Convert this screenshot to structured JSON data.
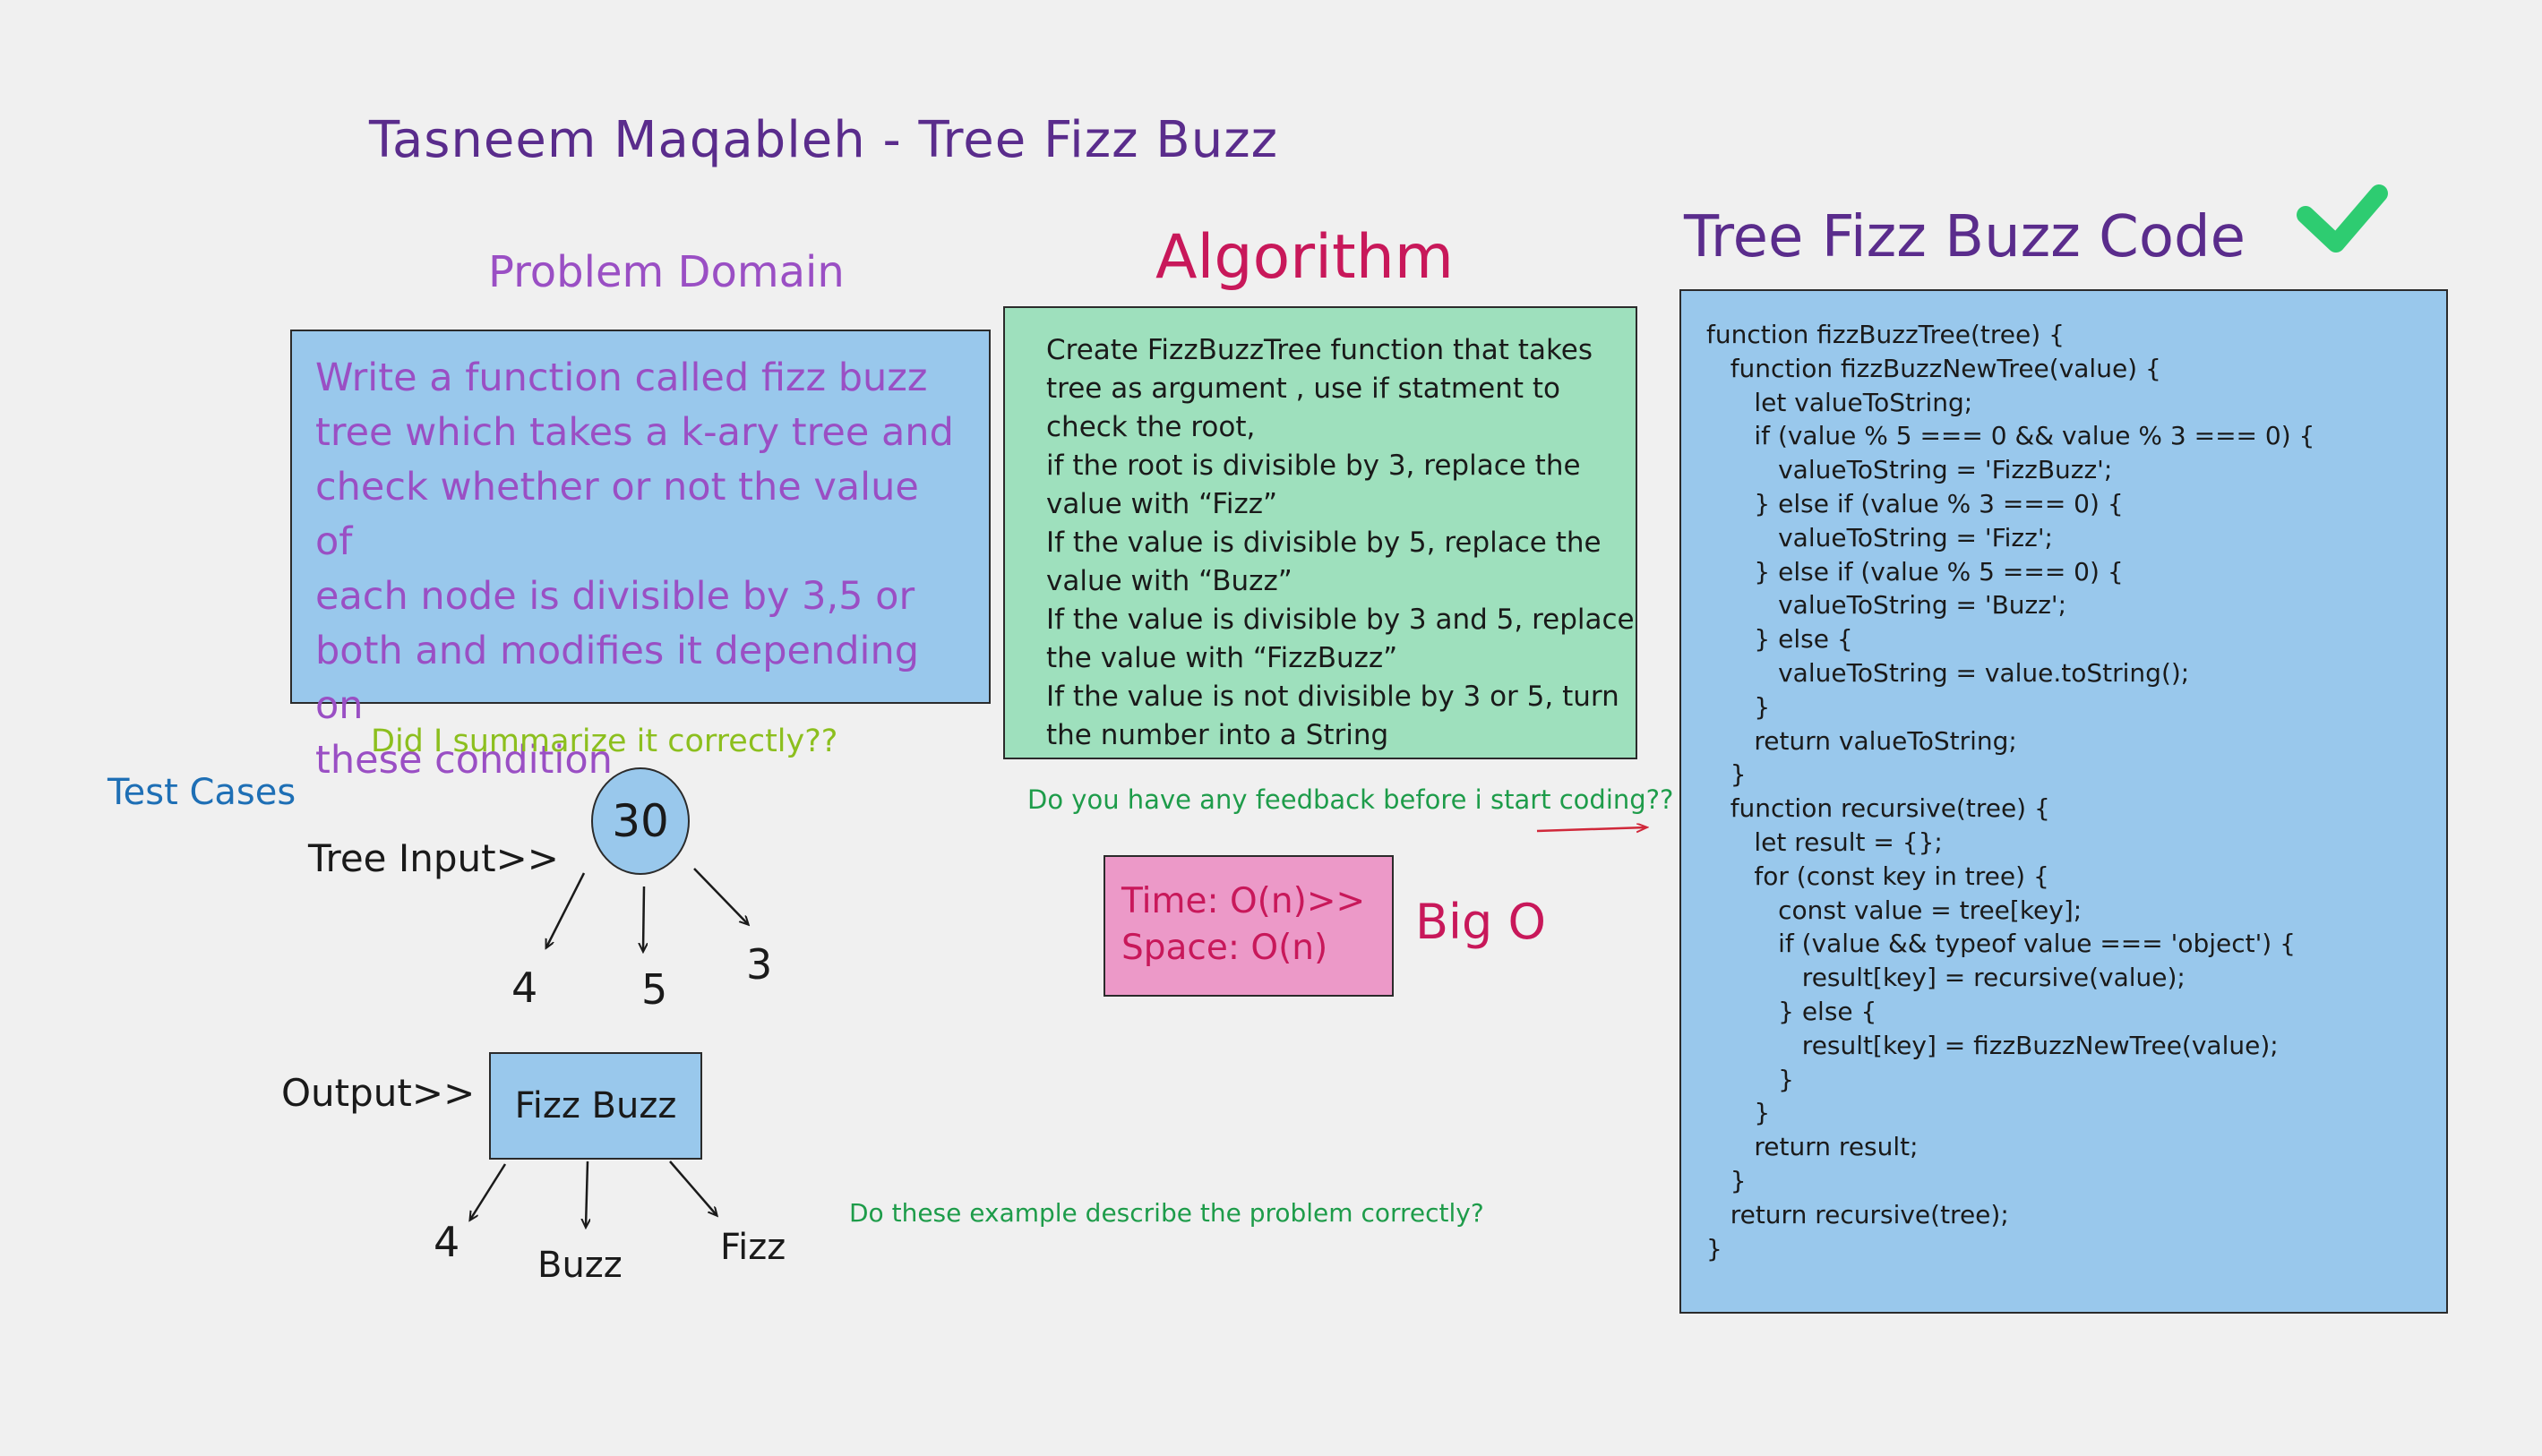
{
  "title": "Tasneem Maqableh  - Tree Fizz Buzz",
  "problem_domain": {
    "heading": "Problem Domain",
    "lines": [
      "Write a function called fizz buzz",
      "tree which takes a k-ary tree and",
      "check whether or not the value of",
      "each node is divisible by 3,5 or",
      "both and modifies it depending on",
      "these condition"
    ],
    "question": "Did I summarize it correctly??"
  },
  "test_cases": {
    "heading": "Test Cases",
    "input_label": "Tree Input>>",
    "root": "30",
    "input_children": [
      "4",
      "5",
      "3"
    ],
    "output_label": "Output>>",
    "output_root": "Fizz Buzz",
    "output_children": [
      "4",
      "Buzz",
      "Fizz"
    ],
    "question": "Do these example describe the problem correctly?"
  },
  "algorithm": {
    "heading": "Algorithm",
    "lines": [
      "Create FizzBuzzTree function that takes",
      "tree as argument , use if statment to",
      "check the root,",
      "if the root is divisible by 3, replace the",
      "value with “Fizz”",
      "If the value is divisible by 5, replace the",
      "value with “Buzz”",
      "If the value is divisible by 3 and 5, replace",
      "the value with “FizzBuzz”",
      "If the value is not divisible by 3 or 5, turn",
      "the number into a String"
    ],
    "feedback_question": "Do you have any feedback before i start coding??"
  },
  "big_o": {
    "time": "Time: O(n)>>",
    "space": "Space: O(n)",
    "label": "Big O"
  },
  "code": {
    "heading": "Tree Fizz Buzz Code",
    "check_icon": "checkmark-icon",
    "check_color": "#2ecc71",
    "lines": [
      "function fizzBuzzTree(tree) {",
      "   function fizzBuzzNewTree(value) {",
      "      let valueToString;",
      "      if (value % 5 === 0 && value % 3 === 0) {",
      "         valueToString = 'FizzBuzz';",
      "      } else if (value % 3 === 0) {",
      "         valueToString = 'Fizz';",
      "      } else if (value % 5 === 0) {",
      "         valueToString = 'Buzz';",
      "      } else {",
      "         valueToString = value.toString();",
      "      }",
      "      return valueToString;",
      "   }",
      "   function recursive(tree) {",
      "      let result = {};",
      "      for (const key in tree) {",
      "         const value = tree[key];",
      "         if (value && typeof value === 'object') {",
      "            result[key] = recursive(value);",
      "         } else {",
      "            result[key] = fizzBuzzNewTree(value);",
      "         }",
      "      }",
      "      return result;",
      "   }",
      "   return recursive(tree);",
      "}"
    ]
  },
  "colors": {
    "blue_box": "#99c8ec",
    "green_box": "#9ee0bd",
    "pink_box": "#ec99c8",
    "purple": "#5a2c8c",
    "magenta": "#c8185a",
    "green_text": "#1e9c4a",
    "lime_text": "#8cbf1e",
    "blue_text": "#1e6fb5"
  }
}
